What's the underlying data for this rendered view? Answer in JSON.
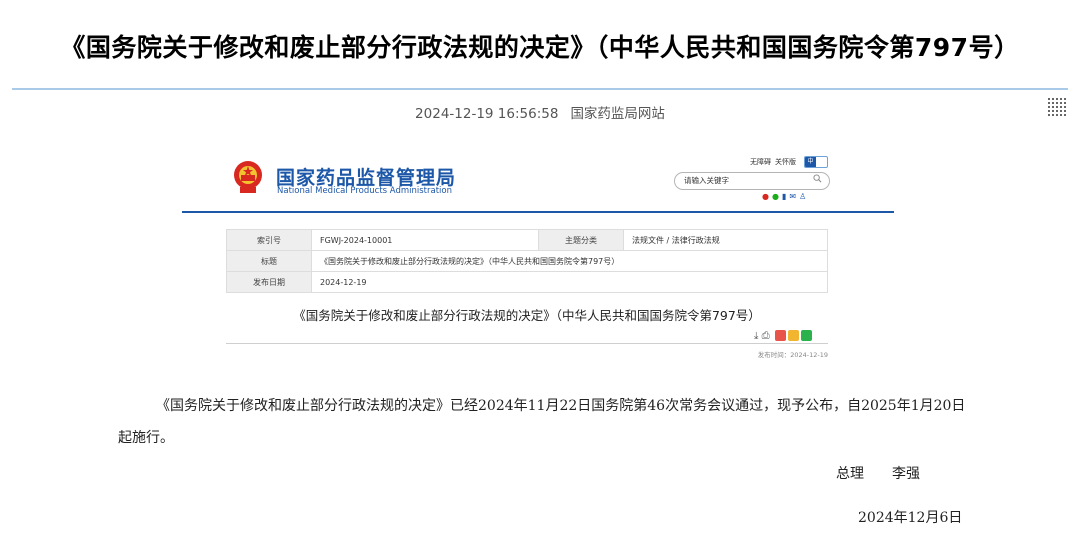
{
  "page": {
    "title": "《国务院关于修改和废止部分行政法规的决定》（中华人民共和国国务院令第797号）",
    "datetime": "2024-12-19 16:56:58",
    "source": "国家药监局网站"
  },
  "header": {
    "brand_cn": "国家药品监督管理局",
    "brand_en": "National Medical Products Administration",
    "accessibility": "无障碍",
    "care_mode": "关怀版",
    "lang_cn": "中",
    "search_placeholder": "请输入关键字",
    "brand_color": "#1d57a8"
  },
  "info_table": {
    "index_label": "索引号",
    "index_value": "FGWJ-2024-10001",
    "category_label": "主题分类",
    "category_value": "法规文件 / 法律行政法规",
    "title_label": "标题",
    "title_value": "《国务院关于修改和废止部分行政法规的决定》（中华人民共和国国务院令第797号）",
    "date_label": "发布日期",
    "date_value": "2024-12-19"
  },
  "doc": {
    "title": "《国务院关于修改和废止部分行政法规的决定》（中华人民共和国国务院令第797号）",
    "pub_time": "发布时间：2024-12-19"
  },
  "body": {
    "paragraph": "《国务院关于修改和废止部分行政法规的决定》已经2024年11月22日国务院第46次常务会议通过，现予公布，自2025年1月20日起施行。",
    "signer_title": "总理",
    "signer_name": "李强",
    "date": "2024年12月6日"
  }
}
